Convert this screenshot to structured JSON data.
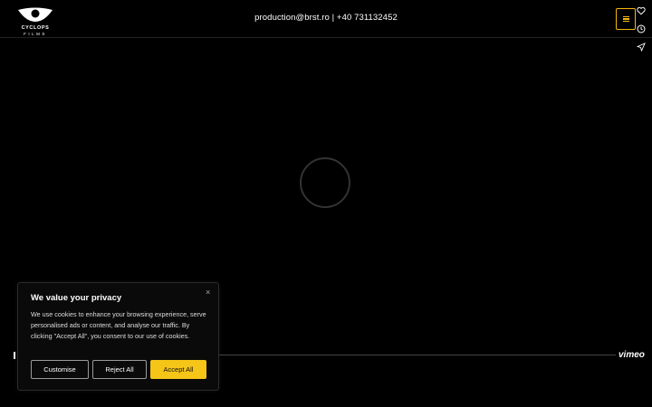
{
  "header": {
    "logo_word": "CYCLOPS",
    "logo_sub": "FILMS",
    "contact": "production@brst.ro | +40 731132452"
  },
  "player": {
    "brand": "vimeo"
  },
  "cookie_banner": {
    "title": "We value your privacy",
    "text": "We use cookies to enhance your browsing experience, serve personalised ads or content, and analyse our traffic. By clicking \"Accept All\", you consent to our use of cookies.",
    "close_label": "×",
    "buttons": {
      "customise": "Customise",
      "reject": "Reject All",
      "accept": "Accept All"
    }
  },
  "colors": {
    "accent": "#f5c518",
    "background": "#000000"
  }
}
